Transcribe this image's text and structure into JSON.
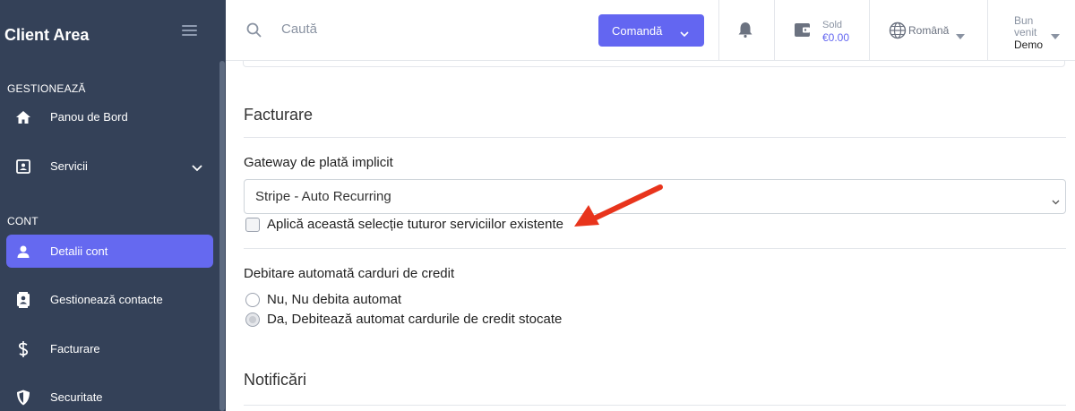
{
  "sidebar": {
    "brand": "Client Area",
    "sections": {
      "manage": "GESTIONEAZĂ",
      "account": "CONT"
    },
    "items": [
      {
        "label": "Panou de Bord",
        "icon": "home-icon"
      },
      {
        "label": "Servicii",
        "icon": "id-card-icon"
      },
      {
        "label": "Detalii cont",
        "icon": "user-icon",
        "active": true
      },
      {
        "label": "Gestionează contacte",
        "icon": "contacts-icon"
      },
      {
        "label": "Facturare",
        "icon": "dollar-icon"
      },
      {
        "label": "Securitate",
        "icon": "shield-icon"
      }
    ]
  },
  "topbar": {
    "search_placeholder": "Caută",
    "order_label": "Comandă",
    "sold_label": "Sold",
    "sold_value": "€0.00",
    "language": "Română",
    "user_line1": "Bun",
    "user_line2": "venit",
    "user_company": "Demo"
  },
  "main": {
    "billing_title": "Facturare",
    "gateway_label": "Gateway de plată implicit",
    "gateway_value": "Stripe - Auto Recurring",
    "apply_all_label": "Aplică această selecție tuturor serviciilor existente",
    "autodebit_label": "Debitare automată carduri de credit",
    "radio_no": "Nu, Nu debita automat",
    "radio_yes": "Da, Debitează automat cardurile de credit stocate",
    "notifications_title": "Notificări"
  },
  "colors": {
    "sidebar_bg": "#344158",
    "accent": "#6366f1",
    "annotation_arrow": "#e8341c"
  }
}
